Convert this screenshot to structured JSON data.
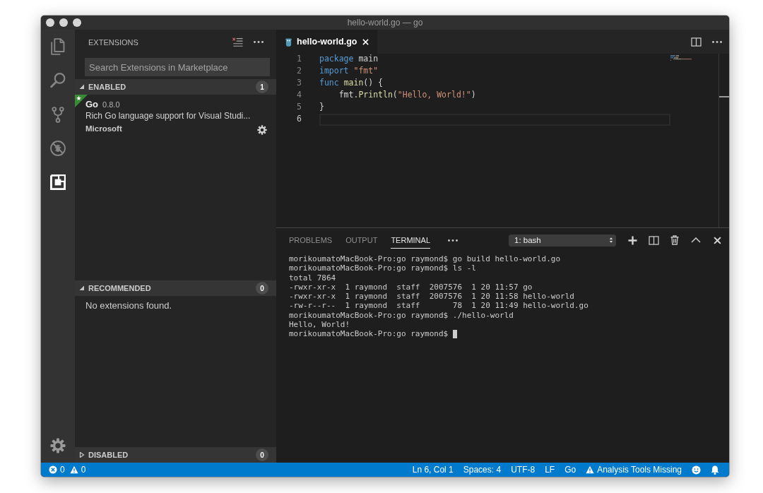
{
  "window": {
    "title": "hello-world.go — go"
  },
  "activity_bar": {
    "items": [
      {
        "kind": "files",
        "selected": false
      },
      {
        "kind": "search",
        "selected": false
      },
      {
        "kind": "source-control",
        "selected": false
      },
      {
        "kind": "debug",
        "selected": false
      },
      {
        "kind": "extensions",
        "selected": true
      }
    ]
  },
  "sidebar": {
    "title": "EXTENSIONS",
    "search": {
      "placeholder": "Search Extensions in Marketplace"
    },
    "sections": [
      {
        "title": "ENABLED",
        "expanded": true,
        "count": "1",
        "extensions": [
          {
            "name": "Go",
            "version": "0.8.0",
            "description": "Rich Go language support for Visual Studi...",
            "publisher": "Microsoft",
            "starred": true
          }
        ]
      },
      {
        "title": "RECOMMENDED",
        "expanded": true,
        "count": "0",
        "message": "No extensions found."
      },
      {
        "title": "DISABLED",
        "expanded": false,
        "count": "0"
      }
    ]
  },
  "editor": {
    "tabs": [
      {
        "label": "hello-world.go",
        "selected": true
      }
    ],
    "lines": [
      {
        "number": "1",
        "current": false,
        "tokens": [
          {
            "kind": "keyword",
            "text": "package"
          },
          {
            "kind": "plain",
            "text": " main"
          }
        ]
      },
      {
        "number": "2",
        "current": false,
        "tokens": [
          {
            "kind": "keyword",
            "text": "import"
          },
          {
            "kind": "string",
            "text": " \"fmt\""
          }
        ]
      },
      {
        "number": "3",
        "current": false,
        "tokens": [
          {
            "kind": "keyword",
            "text": "func"
          },
          {
            "kind": "function",
            "text": " main"
          },
          {
            "kind": "plain",
            "text": "() {"
          }
        ]
      },
      {
        "number": "4",
        "current": false,
        "tokens": [
          {
            "kind": "plain",
            "text": "    fmt."
          },
          {
            "kind": "function",
            "text": "Println"
          },
          {
            "kind": "plain",
            "text": "("
          },
          {
            "kind": "string",
            "text": "\"Hello, World!\""
          },
          {
            "kind": "plain",
            "text": ")"
          }
        ]
      },
      {
        "number": "5",
        "current": false,
        "tokens": [
          {
            "kind": "plain",
            "text": "}"
          }
        ]
      },
      {
        "number": "6",
        "current": true
      }
    ]
  },
  "panel": {
    "tabs": [
      {
        "label": "PROBLEMS",
        "selected": false
      },
      {
        "label": "OUTPUT",
        "selected": false
      },
      {
        "label": "TERMINAL",
        "selected": true
      }
    ],
    "terminal_select": {
      "value": "1: bash"
    },
    "terminal": {
      "lines": [
        "morikoumatoMacBook-Pro:go raymond$ go build hello-world.go",
        "morikoumatoMacBook-Pro:go raymond$ ls -l",
        "total 7864",
        "-rwxr-xr-x  1 raymond  staff  2007576  1 20 11:57 go",
        "-rwxr-xr-x  1 raymond  staff  2007576  1 20 11:58 hello-world",
        "-rw-r--r--  1 raymond  staff       78  1 20 11:49 hello-world.go",
        "morikoumatoMacBook-Pro:go raymond$ ./hello-world",
        "Hello, World!",
        "morikoumatoMacBook-Pro:go raymond$"
      ],
      "cursor": true
    }
  },
  "status_bar": {
    "left": [
      {
        "kind": "errors",
        "text": "0"
      },
      {
        "kind": "warnings",
        "text": "0"
      }
    ],
    "right": [
      {
        "kind": "text",
        "text": "Ln 6, Col 1"
      },
      {
        "kind": "text",
        "text": "Spaces: 4"
      },
      {
        "kind": "text",
        "text": "UTF-8"
      },
      {
        "kind": "text",
        "text": "LF"
      },
      {
        "kind": "text",
        "text": "Go"
      },
      {
        "kind": "warning",
        "text": "Analysis Tools Missing"
      },
      {
        "kind": "feedback"
      },
      {
        "kind": "notifications"
      }
    ]
  }
}
